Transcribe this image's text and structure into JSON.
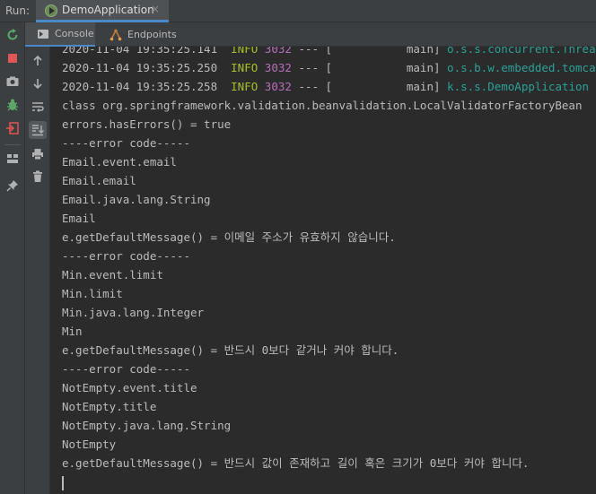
{
  "run_panel": {
    "label": "Run:",
    "tab": {
      "title": "DemoApplication",
      "close": "×"
    },
    "subtabs": [
      {
        "label": "Console",
        "icon": "console-icon"
      },
      {
        "label": "Endpoints",
        "icon": "endpoints-icon"
      }
    ]
  },
  "left_toolbar": [
    "rerun-icon",
    "stop-icon",
    "camera-icon",
    "debug-bug-icon",
    "exit-icon",
    "layout-icon",
    "pin-icon"
  ],
  "console_toolbar": [
    "up-arrow-icon",
    "down-arrow-icon",
    "soft-wrap-icon",
    "scroll-to-end-icon",
    "print-icon",
    "trash-icon"
  ],
  "colors": {
    "info": "#a8c023",
    "pid": "#b66dbb",
    "logger": "#2aa198",
    "text": "#bbbbbb",
    "background": "#2b2b2b"
  },
  "console": {
    "log_lines": [
      {
        "time": "2020-11-04 19:35:25.141",
        "level": "INFO",
        "pid": "3032",
        "sep": "--- [",
        "thread": "main]",
        "logger": "o.s.s.concurrent.ThreadPoolTaskExecutor"
      },
      {
        "time": "2020-11-04 19:35:25.250",
        "level": "INFO",
        "pid": "3032",
        "sep": "--- [",
        "thread": "main]",
        "logger": "o.s.b.w.embedded.tomcat.TomcatWebServer"
      },
      {
        "time": "2020-11-04 19:35:25.258",
        "level": "INFO",
        "pid": "3032",
        "sep": "--- [",
        "thread": "main]",
        "logger": "k.s.s.DemoApplication"
      }
    ],
    "output_lines": [
      "class org.springframework.validation.beanvalidation.LocalValidatorFactoryBean",
      "errors.hasErrors() = true",
      "----error code-----",
      "Email.event.email",
      "Email.email",
      "Email.java.lang.String",
      "Email",
      "e.getDefaultMessage() = 이메일 주소가 유효하지 않습니다.",
      "----error code-----",
      "Min.event.limit",
      "Min.limit",
      "Min.java.lang.Integer",
      "Min",
      "e.getDefaultMessage() = 반드시 0보다 같거나 커야 합니다.",
      "----error code-----",
      "NotEmpty.event.title",
      "NotEmpty.title",
      "NotEmpty.java.lang.String",
      "NotEmpty",
      "e.getDefaultMessage() = 반드시 값이 존재하고 길이 혹은 크기가 0보다 커야 합니다."
    ]
  }
}
